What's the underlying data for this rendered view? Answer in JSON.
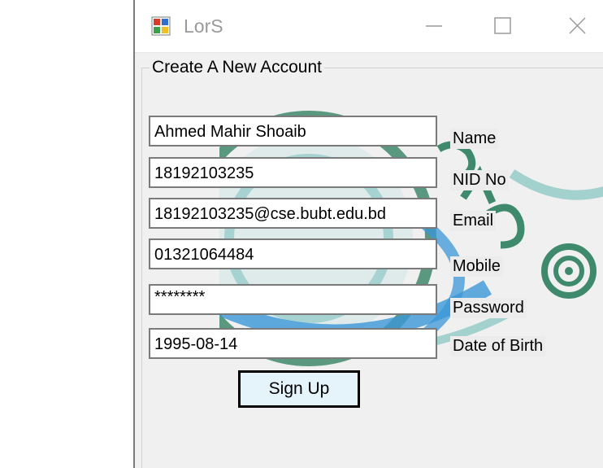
{
  "window": {
    "title": "LorS"
  },
  "form": {
    "group_title": "Create A New Account",
    "fields": [
      {
        "value": "Ahmed Mahir Shoaib",
        "label": "Name"
      },
      {
        "value": "18192103235",
        "label": "NID No"
      },
      {
        "value": "18192103235@cse.bubt.edu.bd",
        "label": "Email"
      },
      {
        "value": "01321064484",
        "label": "Mobile"
      },
      {
        "value": "********",
        "label": "Password"
      },
      {
        "value": "1995-08-14",
        "label": "Date of Birth"
      }
    ],
    "signup_label": "Sign Up"
  },
  "colors": {
    "art_green": "#3f8a6c",
    "art_blue": "#3b97d8",
    "art_teal": "#8ec9c6",
    "button_bg": "#e5f3fb"
  },
  "icons": {
    "app": "app-icon",
    "minimize": "minimize-icon",
    "maximize": "maximize-icon",
    "close": "close-icon"
  }
}
